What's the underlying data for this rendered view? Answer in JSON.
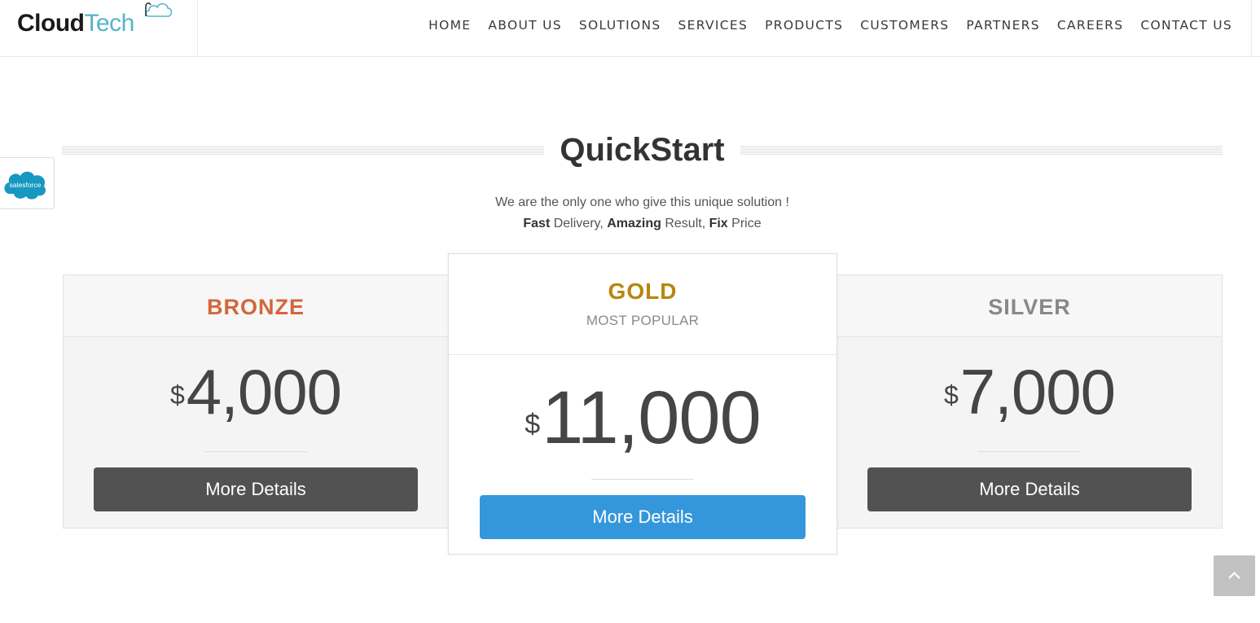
{
  "brand": {
    "part1": "Cloud",
    "part2": "Tech"
  },
  "nav": [
    {
      "label": "HOME"
    },
    {
      "label": "ABOUT US"
    },
    {
      "label": "SOLUTIONS"
    },
    {
      "label": "SERVICES"
    },
    {
      "label": "PRODUCTS"
    },
    {
      "label": "CUSTOMERS"
    },
    {
      "label": "PARTNERS"
    },
    {
      "label": "CAREERS"
    },
    {
      "label": "CONTACT US"
    }
  ],
  "salesforce_badge": {
    "text": "salesforce"
  },
  "section": {
    "title": "QuickStart",
    "subtitle_line1": "We are the only one who give this unique solution !",
    "subtitle_line2": {
      "w1": "Fast",
      "t1": " Delivery, ",
      "w2": "Amazing",
      "t2": " Result, ",
      "w3": "Fix",
      "t3": " Price"
    }
  },
  "plans": [
    {
      "name": "BRONZE",
      "currency": "$",
      "amount": "4,000",
      "button": "More Details"
    },
    {
      "name": "GOLD",
      "subtitle": "MOST POPULAR",
      "currency": "$",
      "amount": "11,000",
      "button": "More Details"
    },
    {
      "name": "SILVER",
      "currency": "$",
      "amount": "7,000",
      "button": "More Details"
    }
  ],
  "colors": {
    "bronze": "#d4663b",
    "gold": "#b8860b",
    "silver": "#888888",
    "primary_button": "#3497db",
    "dark_button": "#525252",
    "brand_tech": "#56b3c9"
  },
  "icons": {
    "scroll_top": "chevron-up-icon",
    "logo_cloud": "cloud-icon"
  }
}
